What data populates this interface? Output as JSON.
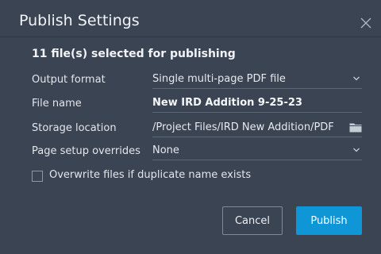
{
  "dialog": {
    "title": "Publish Settings",
    "summary": "11 file(s) selected for publishing"
  },
  "rows": [
    {
      "label": "Output format",
      "value": "Single multi-page PDF file",
      "control": "dropdown"
    },
    {
      "label": "File name",
      "value": "New IRD Addition 9-25-23",
      "control": "text-input"
    },
    {
      "label": "Storage location",
      "value": "/Project Files/IRD New Addition/PDF",
      "control": "folder-picker"
    },
    {
      "label": "Page setup overrides",
      "value": "None",
      "control": "dropdown"
    }
  ],
  "checkbox": {
    "label": "Overwrite files if duplicate name exists",
    "checked": false
  },
  "buttons": {
    "cancel": "Cancel",
    "publish": "Publish"
  },
  "icons": {
    "close": "close-icon",
    "dropdown": "chevron-down-icon",
    "folder": "folder-icon"
  },
  "colors": {
    "background": "#3b4453",
    "primary": "#0e96d6",
    "text": "#e6e9ee"
  }
}
